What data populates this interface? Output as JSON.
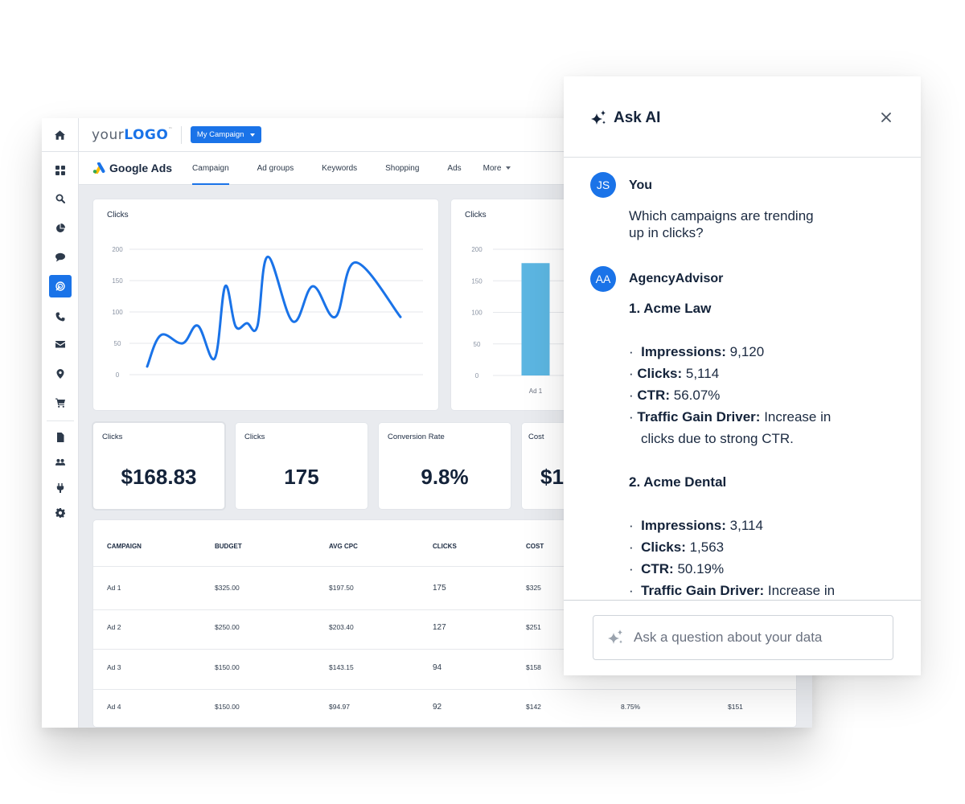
{
  "sidebar": {
    "items": [
      {
        "icon": "home-icon"
      },
      {
        "icon": "grid-icon"
      },
      {
        "icon": "search-icon"
      },
      {
        "icon": "pie-chart-icon"
      },
      {
        "icon": "chat-icon"
      },
      {
        "icon": "target-icon",
        "active": true
      },
      {
        "icon": "phone-icon"
      },
      {
        "icon": "mail-icon"
      },
      {
        "icon": "location-pin-icon"
      },
      {
        "icon": "cart-icon"
      },
      {
        "icon": "document-icon"
      },
      {
        "icon": "users-icon"
      },
      {
        "icon": "plug-icon"
      },
      {
        "icon": "gear-icon"
      }
    ]
  },
  "topbar": {
    "logo_prefix": "your",
    "logo_bold": "LOGO",
    "logo_tm": "™",
    "campaign_selector": "My Campaign"
  },
  "navbar": {
    "product": "Google Ads",
    "tabs": [
      {
        "label": "Campaign",
        "active": true
      },
      {
        "label": "Ad groups"
      },
      {
        "label": "Keywords"
      },
      {
        "label": "Shopping"
      },
      {
        "label": "Ads"
      },
      {
        "label": "More"
      }
    ]
  },
  "chart_data": [
    {
      "type": "line",
      "title": "Clicks",
      "xlabel": "",
      "ylabel": "",
      "x": [
        1,
        2,
        3,
        4,
        5,
        6,
        7,
        8,
        9,
        10,
        11,
        12,
        13,
        14,
        15
      ],
      "values": [
        13,
        63,
        50,
        78,
        26,
        141,
        77,
        82,
        77,
        188,
        85,
        141,
        92,
        179,
        92
      ],
      "ylim": [
        0,
        200
      ],
      "yticks": [
        0,
        50,
        100,
        150,
        200
      ],
      "grid": true,
      "color": "#1a73e8"
    },
    {
      "type": "bar",
      "title": "Clicks",
      "categories": [
        "Ad 1"
      ],
      "values": [
        178
      ],
      "ylim": [
        0,
        200
      ],
      "yticks": [
        0,
        50,
        100,
        150,
        200
      ],
      "grid": true,
      "color": "#5cb6e2"
    }
  ],
  "kpis": [
    {
      "title": "Clicks",
      "value": "$168.83"
    },
    {
      "title": "Clicks",
      "value": "175"
    },
    {
      "title": "Conversion Rate",
      "value": "9.8%"
    },
    {
      "title": "Cost",
      "value": "$1"
    }
  ],
  "table": {
    "headers": [
      "CAMPAIGN",
      "BUDGET",
      "AVG CPC",
      "CLICKS",
      "COST"
    ],
    "rows": [
      [
        "Ad 1",
        "$325.00",
        "$197.50",
        "175",
        "$325",
        "",
        ""
      ],
      [
        "Ad 2",
        "$250.00",
        "$203.40",
        "127",
        "$251",
        "",
        ""
      ],
      [
        "Ad 3",
        "$150.00",
        "$143.15",
        "94",
        "$158",
        "",
        ""
      ],
      [
        "Ad 4",
        "$150.00",
        "$94.97",
        "92",
        "$142",
        "8.75%",
        "$151"
      ]
    ]
  },
  "ai_panel": {
    "title": "Ask AI",
    "close_label": "×",
    "user": {
      "initials": "JS",
      "name": "You",
      "message_line1": "Which campaigns are trending",
      "message_line2": "up in clicks?"
    },
    "assistant": {
      "initials": "AA",
      "name": "AgencyAdvisor",
      "items": [
        {
          "heading": "1. Acme Law",
          "bullets": [
            {
              "label": "Impressions:",
              "value": "9,120"
            },
            {
              "label": "Clicks:",
              "value": "5,114"
            },
            {
              "label": "CTR:",
              "value": "56.07%"
            },
            {
              "label": "Traffic Gain Driver:",
              "value": "Increase in",
              "continuation": "clicks due to strong CTR."
            }
          ]
        },
        {
          "heading": "2. Acme Dental",
          "bullets": [
            {
              "label": "Impressions:",
              "value": "3,114"
            },
            {
              "label": "Clicks:",
              "value": "1,563"
            },
            {
              "label": "CTR:",
              "value": "50.19%"
            },
            {
              "label": "Traffic Gain Driver:",
              "value": "Increase in"
            }
          ]
        }
      ]
    },
    "input_placeholder": "Ask a question about your data"
  },
  "colors": {
    "accent": "#1a73e8",
    "bar": "#5cb6e2",
    "text_dark": "#14233a",
    "background": "#e9ebef"
  }
}
